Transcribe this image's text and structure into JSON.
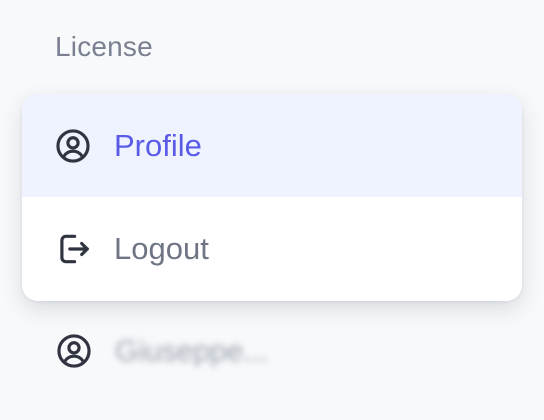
{
  "section": {
    "label": "License"
  },
  "menu": {
    "items": [
      {
        "label": "Profile",
        "icon": "user-circle-icon",
        "active": true,
        "color": "#5b5ce6"
      },
      {
        "label": "Logout",
        "icon": "logout-icon",
        "active": false,
        "color": "#6f7584"
      }
    ],
    "active_background": "#eef3ff"
  },
  "user": {
    "name": "Giuseppe...",
    "icon": "user-circle-icon"
  }
}
